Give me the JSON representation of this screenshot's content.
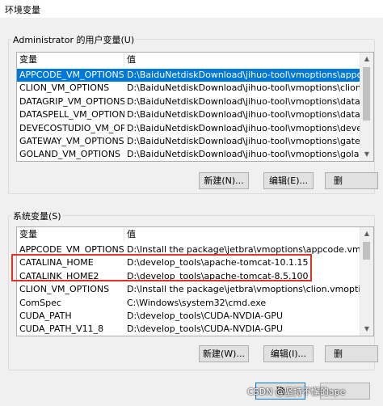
{
  "window": {
    "title": "环境变量"
  },
  "user_section": {
    "label": "Administrator 的用户变量(U)",
    "columns": [
      "变量",
      "值"
    ],
    "rows": [
      {
        "name": "APPCODE_VM_OPTIONS",
        "value": "D:\\BaiduNetdiskDownload\\jihuo-tool\\vmoptions\\appcode.v..."
      },
      {
        "name": "CLION_VM_OPTIONS",
        "value": "D:\\BaiduNetdiskDownload\\jihuo-tool\\vmoptions\\clion.vmoptions"
      },
      {
        "name": "DATAGRIP_VM_OPTIONS",
        "value": "D:\\BaiduNetdiskDownload\\jihuo-tool\\vmoptions\\datagrip.vmo..."
      },
      {
        "name": "DATASPELL_VM_OPTIONS",
        "value": "D:\\BaiduNetdiskDownload\\jihuo-tool\\vmoptions\\dataspell.vm..."
      },
      {
        "name": "DEVECOSTUDIO_VM_OPTIONS",
        "value": "D:\\BaiduNetdiskDownload\\jihuo-tool\\vmoptions\\devecostudi..."
      },
      {
        "name": "GATEWAY_VM_OPTIONS",
        "value": "D:\\BaiduNetdiskDownload\\jihuo-tool\\vmoptions\\gateway.vmo..."
      },
      {
        "name": "GOLAND_VM_OPTIONS",
        "value": "D:\\BaiduNetdiskDownload\\jihuo-tool\\vmoptions\\goland.vmo..."
      }
    ],
    "selected_index": 0,
    "buttons": {
      "new": "新建(N)...",
      "edit": "编辑(E)...",
      "delete": "删"
    }
  },
  "system_section": {
    "label": "系统变量(S)",
    "columns": [
      "变量",
      "值"
    ],
    "rows": [
      {
        "name": "APPCODE_VM_OPTIONS",
        "value": "D:\\Install the package\\jetbra\\vmoptions\\appcode.vmoptions"
      },
      {
        "name": "CATALINA_HOME",
        "value": "D:\\develop_tools\\apache-tomcat-10.1.15"
      },
      {
        "name": "CATALINK_HOME2",
        "value": "D:\\develop_tools\\apache-tomcat-8.5.100"
      },
      {
        "name": "CLION_VM_OPTIONS",
        "value": "D:\\Install the package\\jetbra\\vmoptions\\clion.vmoptions"
      },
      {
        "name": "ComSpec",
        "value": "C:\\Windows\\system32\\cmd.exe"
      },
      {
        "name": "CUDA_PATH",
        "value": "D:\\develop_tools\\CUDA-NVDIA-GPU"
      },
      {
        "name": "CUDA_PATH_V11_8",
        "value": "D:\\develop_tools\\CUDA-NVDIA-GPU"
      }
    ],
    "buttons": {
      "new": "新建(W)...",
      "edit": "编辑(I)...",
      "delete": "删"
    }
  },
  "footer": {
    "ok_partial": "确",
    "watermark": "CSDN @坚持不懈的ape"
  },
  "colors": {
    "selection": "#0078d7",
    "highlight": "#e0312b"
  }
}
